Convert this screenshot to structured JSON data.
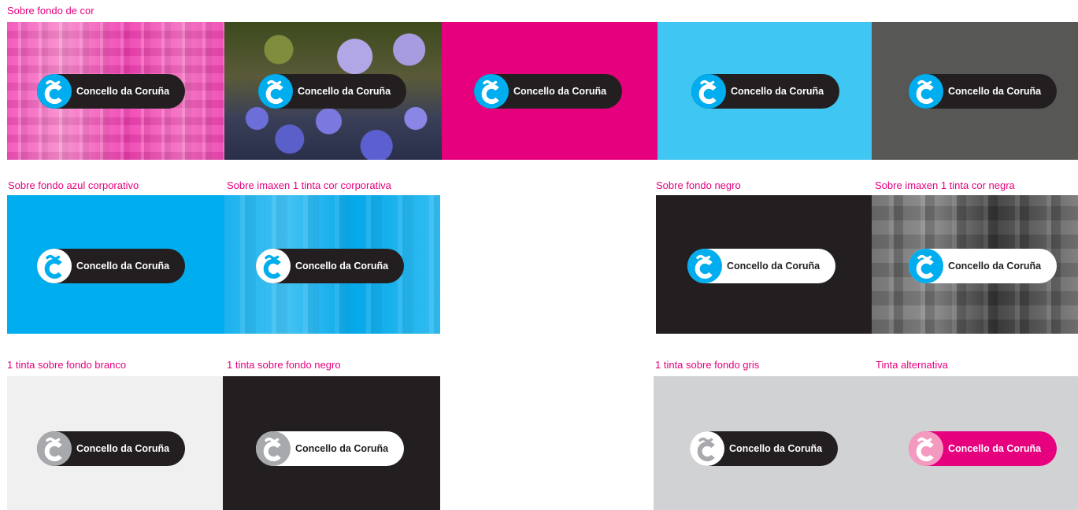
{
  "brand": "Concello da Coruña",
  "colors": {
    "label": "#e6007e",
    "corporate_blue": "#00adee",
    "magenta": "#e6007e",
    "black": "#231f20",
    "white": "#ffffff"
  },
  "icon": "c-tilde-logo-icon",
  "labels": {
    "row1": "Sobre fondo de cor",
    "row2_a": "Sobre fondo azul corporativo",
    "row2_b": "Sobre imaxen 1 tinta cor corporativa",
    "row2_c": "Sobre fondo negro",
    "row2_d": "Sobre imaxen 1 tinta cor negra",
    "row3_a": "1 tinta sobre fondo branco",
    "row3_b": "1 tinta sobre fondo negro",
    "row3_c": "1 tinta sobre fondo gris",
    "row3_d": "Tinta alternativa"
  },
  "tiles": [
    {
      "id": "pink-photo",
      "background": "photo-magenta",
      "pill": {
        "fill": "#231f20",
        "text": "#ffffff",
        "badge": "#00adee",
        "glyph": "#ffffff"
      }
    },
    {
      "id": "flowers-photo",
      "background": "photo-flowers",
      "pill": {
        "fill": "#231f20",
        "text": "#ffffff",
        "badge": "#00adee",
        "glyph": "#ffffff"
      }
    },
    {
      "id": "magenta",
      "background": "#e6007e",
      "pill": {
        "fill": "#231f20",
        "text": "#ffffff",
        "badge": "#00adee",
        "glyph": "#ffffff"
      }
    },
    {
      "id": "light-blue",
      "background": "#3fc6f2",
      "pill": {
        "fill": "#231f20",
        "text": "#ffffff",
        "badge": "#00adee",
        "glyph": "#ffffff"
      }
    },
    {
      "id": "dark-gray",
      "background": "#575756",
      "pill": {
        "fill": "#231f20",
        "text": "#ffffff",
        "badge": "#00adee",
        "glyph": "#ffffff"
      }
    },
    {
      "id": "corp-blue",
      "background": "#00adee",
      "pill": {
        "fill": "#231f20",
        "text": "#ffffff",
        "badge": "#ffffff",
        "glyph": "#00adee"
      }
    },
    {
      "id": "blue-photo",
      "background": "photo-corporate-blue",
      "pill": {
        "fill": "#231f20",
        "text": "#ffffff",
        "badge": "#ffffff",
        "glyph": "#00adee"
      }
    },
    {
      "id": "black",
      "background": "#231f20",
      "pill": {
        "fill": "#ffffff",
        "text": "#231f20",
        "badge": "#00adee",
        "glyph": "#ffffff"
      }
    },
    {
      "id": "gray-photo",
      "background": "photo-black",
      "pill": {
        "fill": "#ffffff",
        "text": "#231f20",
        "badge": "#00adee",
        "glyph": "#ffffff"
      }
    },
    {
      "id": "mono-white",
      "background": "#f0f0f1",
      "pill": {
        "fill": "#231f20",
        "text": "#ffffff",
        "badge": "#a7a9ac",
        "glyph": "#ffffff"
      }
    },
    {
      "id": "mono-black",
      "background": "#231f20",
      "pill": {
        "fill": "#ffffff",
        "text": "#231f20",
        "badge": "#a7a9ac",
        "glyph": "#ffffff"
      }
    },
    {
      "id": "mono-gray",
      "background": "#d1d2d4",
      "pill": {
        "fill": "#231f20",
        "text": "#ffffff",
        "badge": "#ffffff",
        "glyph": "#a7a9ac"
      }
    },
    {
      "id": "alternative",
      "background": "#d1d2d4",
      "pill": {
        "fill": "#e6007e",
        "text": "#ffffff",
        "badge": "#f49ac1",
        "glyph": "#ffffff"
      }
    }
  ]
}
